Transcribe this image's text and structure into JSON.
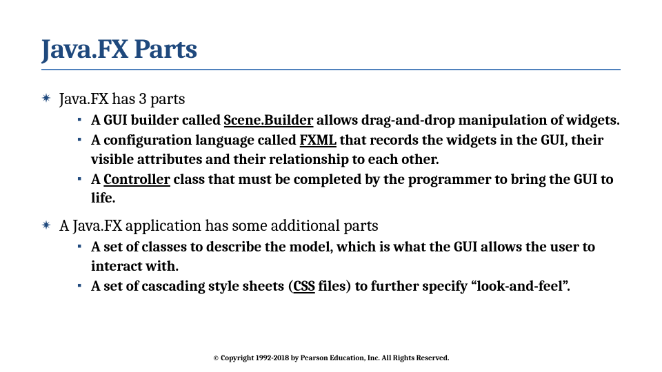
{
  "title": "Java.FX Parts",
  "bullets": [
    {
      "text": "Java.FX has 3 parts",
      "sub": [
        {
          "pre": "A GUI builder called ",
          "u": "Scene.Builder",
          "post": " allows drag-and-drop manipulation of widgets."
        },
        {
          "pre": "A configuration language called ",
          "u": "FXML",
          "post": " that records the widgets in the GUI, their visible attributes and their relationship to each other."
        },
        {
          "pre": "A ",
          "u": "Controller",
          "post": " class that must be completed by the programmer to bring the GUI to life."
        }
      ]
    },
    {
      "text": "A Java.FX application has some additional parts",
      "sub": [
        {
          "pre": "A set of classes to describe the model, which is what the GUI allows the user to interact with.",
          "u": "",
          "post": ""
        },
        {
          "pre": "A set of cascading style sheets (",
          "u": "CSS",
          "post": " files) to further specify “look-and-feel”."
        }
      ]
    }
  ],
  "footer": "© Copyright 1992-2018 by Pearson Education, Inc. All Rights Reserved."
}
